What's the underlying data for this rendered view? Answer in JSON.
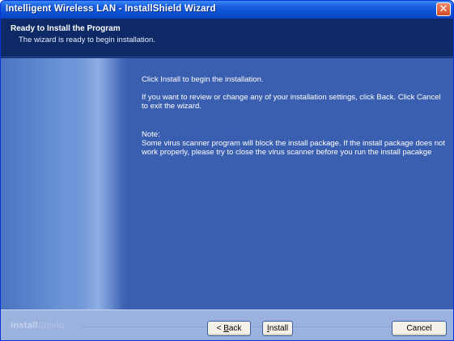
{
  "window": {
    "title": "Intelligent Wireless LAN - InstallShield Wizard",
    "close_glyph": "✕"
  },
  "header": {
    "title": "Ready to Install the Program",
    "subtitle": "The wizard is ready to begin installation."
  },
  "body": {
    "line1": "Click Install to begin the installation.",
    "line2": "If you want to review or change any of your installation settings, click Back. Click Cancel to exit the wizard.",
    "note_label": "Note:",
    "note_text": "Some virus scanner program will block the install package. If the install package does not work properly, please try to close the virus scanner before you run the install pacakge"
  },
  "footer": {
    "brand_main": "Install",
    "brand_light": "Shield",
    "back_prefix": "< ",
    "back_mnemonic": "B",
    "back_rest": "ack",
    "install_mnemonic": "I",
    "install_rest": "nstall",
    "cancel_label": "Cancel"
  }
}
